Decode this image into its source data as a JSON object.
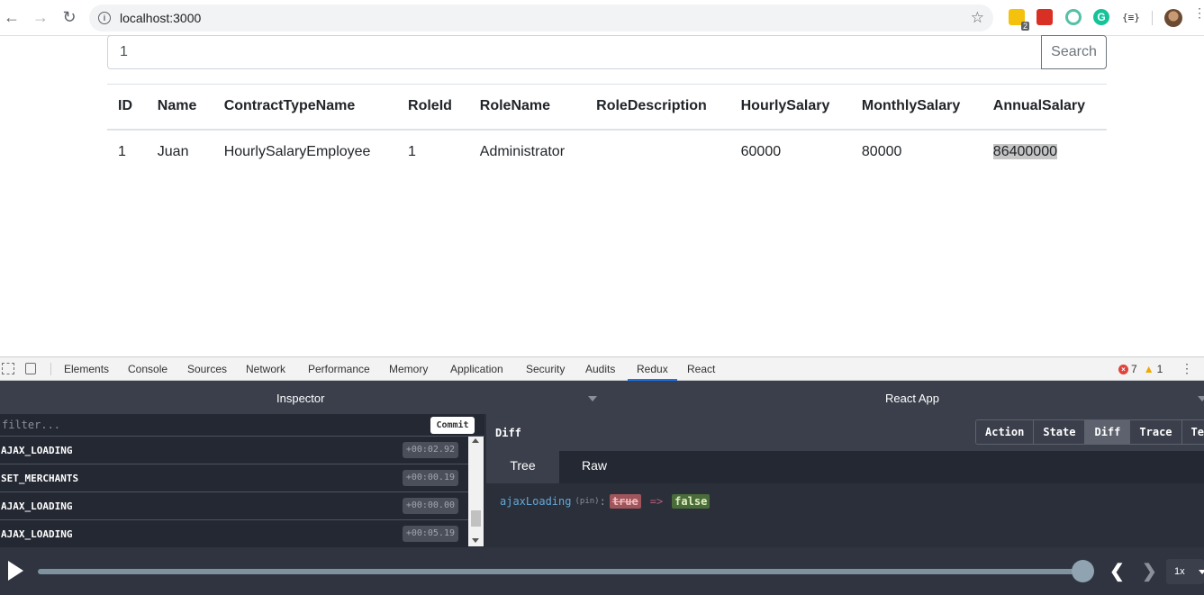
{
  "browser": {
    "url": "localhost:3000",
    "extension_badge": "2",
    "ext5_label": "{≡}"
  },
  "search": {
    "value": "1",
    "button_label": "Search"
  },
  "table": {
    "headers": [
      "ID",
      "Name",
      "ContractTypeName",
      "RoleId",
      "RoleName",
      "RoleDescription",
      "HourlySalary",
      "MonthlySalary",
      "AnnualSalary"
    ],
    "rows": [
      [
        "1",
        "Juan",
        "HourlySalaryEmployee",
        "1",
        "Administrator",
        "",
        "60000",
        "80000",
        "86400000"
      ]
    ]
  },
  "devtools": {
    "tabs": [
      "Elements",
      "Console",
      "Sources",
      "Network",
      "Performance",
      "Memory",
      "Application",
      "Security",
      "Audits",
      "Redux",
      "React"
    ],
    "active_tab": "Redux",
    "error_count": "7",
    "warning_count": "1"
  },
  "redux": {
    "inspector_title": "Inspector",
    "app_title": "React App",
    "filter_placeholder": "filter...",
    "commit_label": "Commit",
    "actions": [
      {
        "name": "AJAX_LOADING",
        "time": "+00:02.92"
      },
      {
        "name": "SET_MERCHANTS",
        "time": "+00:00.19"
      },
      {
        "name": "AJAX_LOADING",
        "time": "+00:00.00"
      },
      {
        "name": "AJAX_LOADING",
        "time": "+00:05.19"
      }
    ],
    "diff_label": "Diff",
    "monitor_buttons": [
      "Action",
      "State",
      "Diff",
      "Trace",
      "Test"
    ],
    "active_monitor": "Diff",
    "view_tabs": [
      "Tree",
      "Raw"
    ],
    "active_view": "Tree",
    "diff": {
      "key": "ajaxLoading",
      "pin": "(pin)",
      "old_value": "true",
      "arrow": "=>",
      "new_value": "false"
    },
    "speed": "1x",
    "slider_position": 1.0
  },
  "colors": {
    "redux_bg": "#2a2f3a",
    "active_tab_underline": "#1a73e8",
    "diff_removed": "#a0545b",
    "diff_added": "#4a6b3a"
  }
}
